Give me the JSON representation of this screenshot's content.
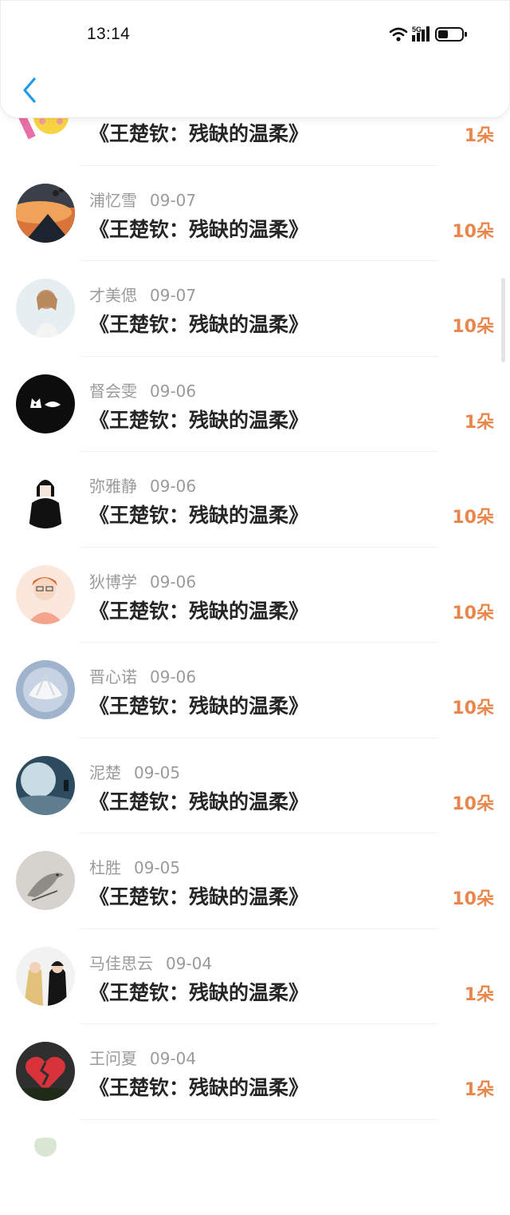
{
  "status_bar": {
    "time": "13:14",
    "network": "5G"
  },
  "rows": [
    {
      "name": "",
      "date": "",
      "book": "《王楚钦：残缺的温柔》",
      "amount": "1朵",
      "avatar": "emoji-face-avatar"
    },
    {
      "name": "浦忆雪",
      "date": "09-07",
      "book": "《王楚钦：残缺的温柔》",
      "amount": "10朵",
      "avatar": "sunset-sky-avatar"
    },
    {
      "name": "才美偲",
      "date": "09-07",
      "book": "《王楚钦：残缺的温柔》",
      "amount": "10朵",
      "avatar": "girl-photo-avatar"
    },
    {
      "name": "督会雯",
      "date": "09-06",
      "book": "《王楚钦：残缺的温柔》",
      "amount": "1朵",
      "avatar": "black-cat-avatar"
    },
    {
      "name": "弥雅静",
      "date": "09-06",
      "book": "《王楚钦：残缺的温柔》",
      "amount": "10朵",
      "avatar": "hoodie-figure-avatar"
    },
    {
      "name": "狄博学",
      "date": "09-06",
      "book": "《王楚钦：残缺的温柔》",
      "amount": "10朵",
      "avatar": "anime-boy-avatar"
    },
    {
      "name": "晋心诺",
      "date": "09-06",
      "book": "《王楚钦：残缺的温柔》",
      "amount": "10朵",
      "avatar": "seashell-avatar"
    },
    {
      "name": "泥楚",
      "date": "09-05",
      "book": "《王楚钦：残缺的温柔》",
      "amount": "10朵",
      "avatar": "moon-night-avatar"
    },
    {
      "name": "杜胜",
      "date": "09-05",
      "book": "《王楚钦：残缺的温柔》",
      "amount": "10朵",
      "avatar": "bird-sketch-avatar"
    },
    {
      "name": "马佳思云",
      "date": "09-04",
      "book": "《王楚钦：残缺的温柔》",
      "amount": "1朵",
      "avatar": "two-girls-avatar"
    },
    {
      "name": "王问夏",
      "date": "09-04",
      "book": "《王楚钦：残缺的温柔》",
      "amount": "1朵",
      "avatar": "broken-heart-avatar"
    },
    {
      "name": "",
      "date": "",
      "book": "",
      "amount": "",
      "avatar": "partial-avatar"
    }
  ],
  "colors": {
    "accent": "#e8864c",
    "back": "#1e9be8",
    "name": "#9a9a9a",
    "title": "#262626"
  }
}
